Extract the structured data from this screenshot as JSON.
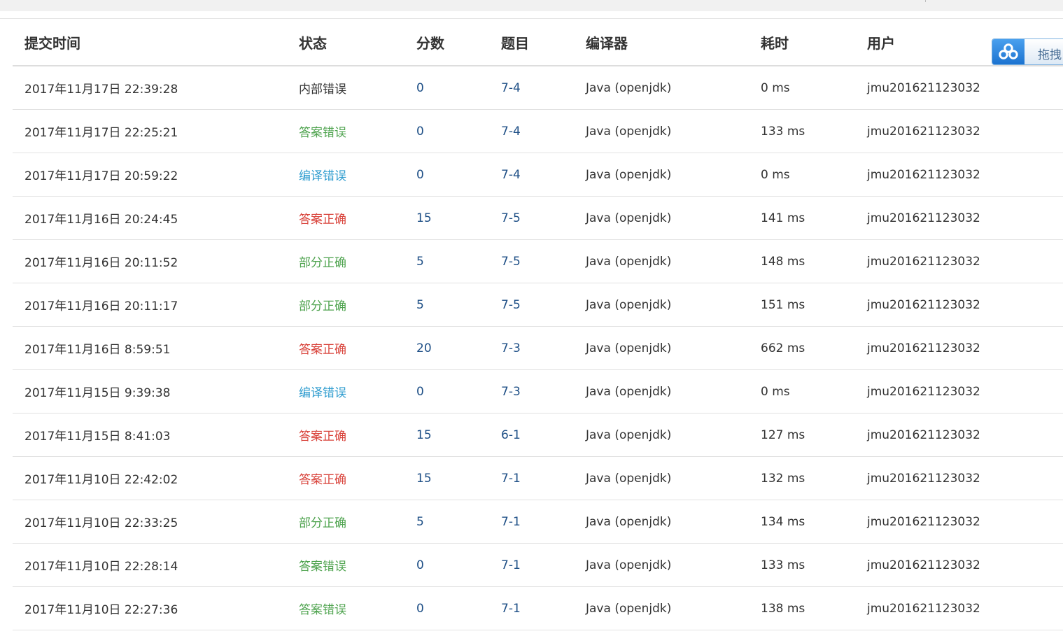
{
  "table": {
    "headers": {
      "time": "提交时间",
      "status": "状态",
      "score": "分数",
      "problem": "题目",
      "compiler": "编译器",
      "cost": "耗时",
      "user": "用户"
    },
    "rows": [
      {
        "time": "2017年11月17日 22:39:28",
        "status": "内部错误",
        "status_color": "#333333",
        "score": "0",
        "problem": "7-4",
        "compiler": "Java (openjdk)",
        "cost": "0 ms",
        "user": "jmu201621123032"
      },
      {
        "time": "2017年11月17日 22:25:21",
        "status": "答案错误",
        "status_color": "#4ea34e",
        "score": "0",
        "problem": "7-4",
        "compiler": "Java (openjdk)",
        "cost": "133 ms",
        "user": "jmu201621123032"
      },
      {
        "time": "2017年11月17日 20:59:22",
        "status": "编译错误",
        "status_color": "#2e9ccf",
        "score": "0",
        "problem": "7-4",
        "compiler": "Java (openjdk)",
        "cost": "0 ms",
        "user": "jmu201621123032"
      },
      {
        "time": "2017年11月16日 20:24:45",
        "status": "答案正确",
        "status_color": "#d9443c",
        "score": "15",
        "problem": "7-5",
        "compiler": "Java (openjdk)",
        "cost": "141 ms",
        "user": "jmu201621123032"
      },
      {
        "time": "2017年11月16日 20:11:52",
        "status": "部分正确",
        "status_color": "#4ea34e",
        "score": "5",
        "problem": "7-5",
        "compiler": "Java (openjdk)",
        "cost": "148 ms",
        "user": "jmu201621123032"
      },
      {
        "time": "2017年11月16日 20:11:17",
        "status": "部分正确",
        "status_color": "#4ea34e",
        "score": "5",
        "problem": "7-5",
        "compiler": "Java (openjdk)",
        "cost": "151 ms",
        "user": "jmu201621123032"
      },
      {
        "time": "2017年11月16日 8:59:51",
        "status": "答案正确",
        "status_color": "#d9443c",
        "score": "20",
        "problem": "7-3",
        "compiler": "Java (openjdk)",
        "cost": "662 ms",
        "user": "jmu201621123032"
      },
      {
        "time": "2017年11月15日 9:39:38",
        "status": "编译错误",
        "status_color": "#2e9ccf",
        "score": "0",
        "problem": "7-3",
        "compiler": "Java (openjdk)",
        "cost": "0 ms",
        "user": "jmu201621123032"
      },
      {
        "time": "2017年11月15日 8:41:03",
        "status": "答案正确",
        "status_color": "#d9443c",
        "score": "15",
        "problem": "6-1",
        "compiler": "Java (openjdk)",
        "cost": "127 ms",
        "user": "jmu201621123032"
      },
      {
        "time": "2017年11月10日 22:42:02",
        "status": "答案正确",
        "status_color": "#d9443c",
        "score": "15",
        "problem": "7-1",
        "compiler": "Java (openjdk)",
        "cost": "132 ms",
        "user": "jmu201621123032"
      },
      {
        "time": "2017年11月10日 22:33:25",
        "status": "部分正确",
        "status_color": "#4ea34e",
        "score": "5",
        "problem": "7-1",
        "compiler": "Java (openjdk)",
        "cost": "134 ms",
        "user": "jmu201621123032"
      },
      {
        "time": "2017年11月10日 22:28:14",
        "status": "答案错误",
        "status_color": "#4ea34e",
        "score": "0",
        "problem": "7-1",
        "compiler": "Java (openjdk)",
        "cost": "133 ms",
        "user": "jmu201621123032"
      },
      {
        "time": "2017年11月10日 22:27:36",
        "status": "答案错误",
        "status_color": "#4ea34e",
        "score": "0",
        "problem": "7-1",
        "compiler": "Java (openjdk)",
        "cost": "138 ms",
        "user": "jmu201621123032"
      }
    ]
  },
  "widget": {
    "label": "拖拽",
    "icon": "baidu-cloud-icon",
    "color": "#1c73d0"
  },
  "colors": {
    "link": "#1e4f86",
    "text": "#333333",
    "border": "#e2e2e2"
  }
}
